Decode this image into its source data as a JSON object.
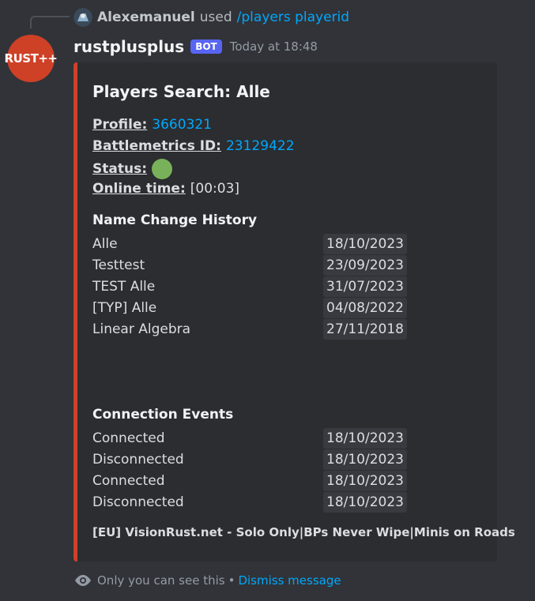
{
  "reply": {
    "user": "Alexemanuel",
    "action": "used",
    "command": "/players playerid"
  },
  "message": {
    "avatar_text": "RUST++",
    "username": "rustplusplus",
    "bot_tag": "BOT",
    "timestamp": "Today at 18:48",
    "accent_color": "#ce4127"
  },
  "embed": {
    "title": "Players Search: Alle",
    "fields": {
      "profile_label": "Profile:",
      "profile_value": "3660321",
      "battlemetrics_label": "Battlemetrics ID:",
      "battlemetrics_value": "23129422",
      "status_label": "Status:",
      "status_icon": "green-circle",
      "online_label": "Online time:",
      "online_value": "[00:03]"
    },
    "name_history": {
      "title": "Name Change History",
      "rows": [
        {
          "name": "Alle",
          "date": "18/10/2023"
        },
        {
          "name": "Testtest",
          "date": "23/09/2023"
        },
        {
          "name": "TEST Alle",
          "date": "31/07/2023"
        },
        {
          "name": "[TYP] Alle",
          "date": "04/08/2022"
        },
        {
          "name": "Linear Algebra",
          "date": "27/11/2018"
        }
      ]
    },
    "connection_events": {
      "title": "Connection Events",
      "rows": [
        {
          "event": "Connected",
          "date": "18/10/2023"
        },
        {
          "event": "Disconnected",
          "date": "18/10/2023"
        },
        {
          "event": "Connected",
          "date": "18/10/2023"
        },
        {
          "event": "Disconnected",
          "date": "18/10/2023"
        }
      ]
    },
    "footer": "[EU] VisionRust.net - Solo Only|BPs Never Wipe|Minis on Roads"
  },
  "ephemeral": {
    "icon": "eye-icon",
    "text": "Only you can see this",
    "separator": "•",
    "dismiss_label": "Dismiss message"
  }
}
